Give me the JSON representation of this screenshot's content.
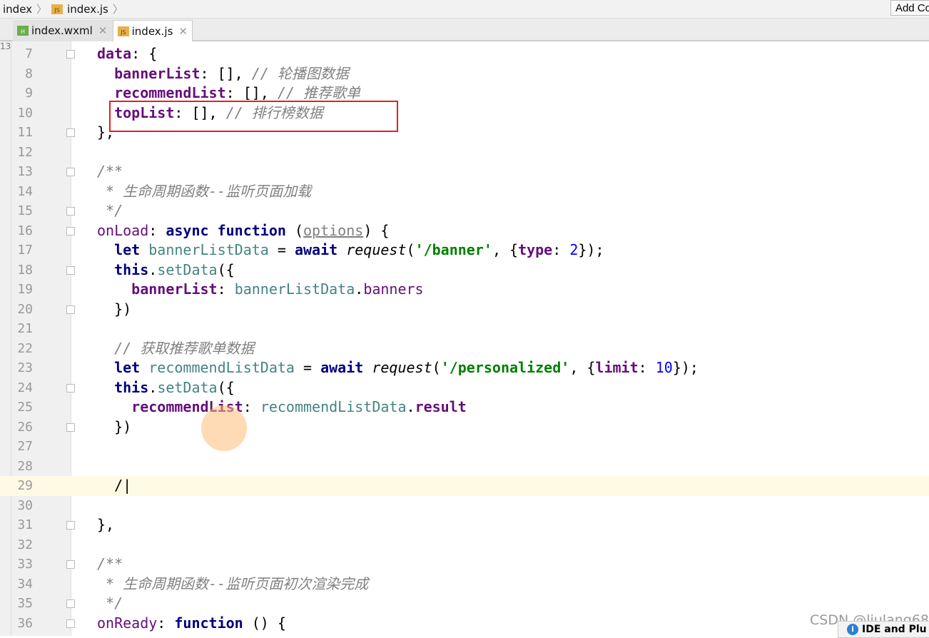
{
  "breadcrumb": [
    "index",
    "index.js"
  ],
  "add_button": "Add Co",
  "tabs": [
    {
      "label": "index.wxml",
      "icon": "wxml-file-icon"
    },
    {
      "label": "index.js",
      "icon": "js-file-icon",
      "active": true
    }
  ],
  "left_strip_num": "13",
  "lines": [
    {
      "n": "7",
      "fold": true,
      "t": [
        [
          "pr",
          "data"
        ],
        [
          "pl",
          ": {"
        ]
      ]
    },
    {
      "n": "8",
      "t": [
        [
          "pl",
          "  "
        ],
        [
          "pr",
          "bannerList"
        ],
        [
          "pl",
          ": [], "
        ],
        [
          "cm",
          "// 轮播图数据"
        ]
      ]
    },
    {
      "n": "9",
      "t": [
        [
          "pl",
          "  "
        ],
        [
          "pr",
          "recommendList"
        ],
        [
          "pl",
          ": [], "
        ],
        [
          "cm",
          "// 推荐歌单"
        ]
      ]
    },
    {
      "n": "10",
      "t": [
        [
          "pl",
          "  "
        ],
        [
          "pr",
          "topList"
        ],
        [
          "pl",
          ": [], "
        ],
        [
          "cm",
          "// 排行榜数据"
        ]
      ]
    },
    {
      "n": "11",
      "fold": true,
      "t": [
        [
          "pl",
          "},"
        ]
      ]
    },
    {
      "n": "12",
      "t": []
    },
    {
      "n": "13",
      "fold": true,
      "t": [
        [
          "cm",
          "/**"
        ]
      ]
    },
    {
      "n": "14",
      "t": [
        [
          "cm",
          " * 生命周期函数--监听页面加载"
        ]
      ]
    },
    {
      "n": "15",
      "fold": true,
      "t": [
        [
          "cm",
          " */"
        ]
      ]
    },
    {
      "n": "16",
      "fold": true,
      "t": [
        [
          "prn",
          "onLoad"
        ],
        [
          "pl",
          ": "
        ],
        [
          "kw",
          "async function "
        ],
        [
          "pl",
          "("
        ],
        [
          "ul",
          "options"
        ],
        [
          "pl",
          ") {"
        ]
      ]
    },
    {
      "n": "17",
      "t": [
        [
          "pl",
          "  "
        ],
        [
          "kw",
          "let "
        ],
        [
          "lv",
          "bannerListData"
        ],
        [
          "pl",
          " = "
        ],
        [
          "kw",
          "await "
        ],
        [
          "fn",
          "request"
        ],
        [
          "pl",
          "("
        ],
        [
          "st",
          "'/banner'"
        ],
        [
          "pl",
          ", {"
        ],
        [
          "pr",
          "type"
        ],
        [
          "pl",
          ": "
        ],
        [
          "nu",
          "2"
        ],
        [
          "pl",
          "});"
        ]
      ]
    },
    {
      "n": "18",
      "fold": true,
      "t": [
        [
          "pl",
          "  "
        ],
        [
          "kw",
          "this"
        ],
        [
          "pl",
          "."
        ],
        [
          "lv",
          "setData"
        ],
        [
          "pl",
          "({"
        ]
      ]
    },
    {
      "n": "19",
      "t": [
        [
          "pl",
          "    "
        ],
        [
          "pr",
          "bannerList"
        ],
        [
          "pl",
          ": "
        ],
        [
          "lv",
          "bannerListData"
        ],
        [
          "pl",
          "."
        ],
        [
          "prn",
          "banners"
        ]
      ]
    },
    {
      "n": "20",
      "fold": true,
      "t": [
        [
          "pl",
          "  })"
        ]
      ]
    },
    {
      "n": "21",
      "t": []
    },
    {
      "n": "22",
      "t": [
        [
          "pl",
          "  "
        ],
        [
          "cm",
          "// 获取推荐歌单数据"
        ]
      ]
    },
    {
      "n": "23",
      "t": [
        [
          "pl",
          "  "
        ],
        [
          "kw",
          "let "
        ],
        [
          "lv",
          "recommendListData"
        ],
        [
          "pl",
          " = "
        ],
        [
          "kw",
          "await "
        ],
        [
          "fn",
          "request"
        ],
        [
          "pl",
          "("
        ],
        [
          "st",
          "'/personalized'"
        ],
        [
          "pl",
          ", {"
        ],
        [
          "pr",
          "limit"
        ],
        [
          "pl",
          ": "
        ],
        [
          "nu",
          "10"
        ],
        [
          "pl",
          "});"
        ]
      ]
    },
    {
      "n": "24",
      "fold": true,
      "t": [
        [
          "pl",
          "  "
        ],
        [
          "kw",
          "this"
        ],
        [
          "pl",
          "."
        ],
        [
          "lv",
          "setData"
        ],
        [
          "pl",
          "({"
        ]
      ]
    },
    {
      "n": "25",
      "t": [
        [
          "pl",
          "    "
        ],
        [
          "pr",
          "recommendList"
        ],
        [
          "pl",
          ": "
        ],
        [
          "lv",
          "recommendListData"
        ],
        [
          "pl",
          "."
        ],
        [
          "pr",
          "result"
        ]
      ]
    },
    {
      "n": "26",
      "fold": true,
      "t": [
        [
          "pl",
          "  })"
        ]
      ]
    },
    {
      "n": "27",
      "t": []
    },
    {
      "n": "28",
      "t": []
    },
    {
      "n": "29",
      "cur": true,
      "t": [
        [
          "pl",
          "  /|"
        ]
      ]
    },
    {
      "n": "30",
      "t": []
    },
    {
      "n": "31",
      "fold": true,
      "t": [
        [
          "pl",
          "},"
        ]
      ]
    },
    {
      "n": "32",
      "t": []
    },
    {
      "n": "33",
      "fold": true,
      "t": [
        [
          "cm",
          "/**"
        ]
      ]
    },
    {
      "n": "34",
      "t": [
        [
          "cm",
          " * 生命周期函数--监听页面初次渲染完成"
        ]
      ]
    },
    {
      "n": "35",
      "fold": true,
      "t": [
        [
          "cm",
          " */"
        ]
      ]
    },
    {
      "n": "36",
      "fold": true,
      "t": [
        [
          "prn",
          "onReady"
        ],
        [
          "pl",
          ": "
        ],
        [
          "kw",
          "function "
        ],
        [
          "pl",
          "() {"
        ]
      ]
    }
  ],
  "watermark": "CSDN @liulang68",
  "notification": "IDE and Plu"
}
